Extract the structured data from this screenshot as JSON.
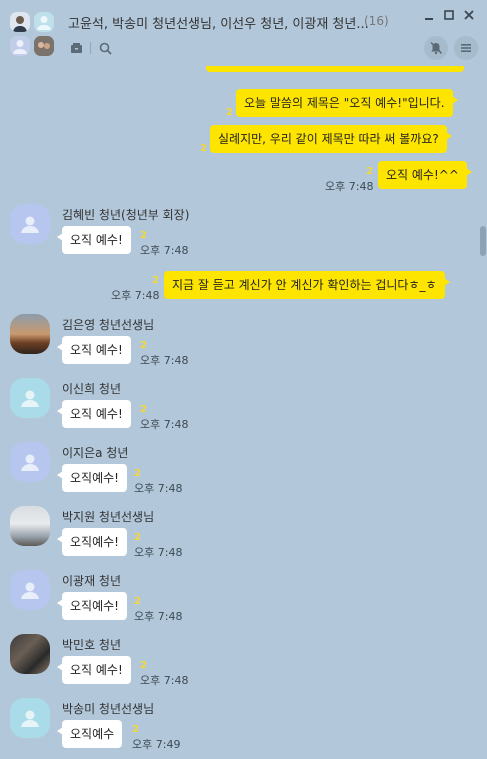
{
  "header": {
    "title": "고윤석, 박송미 청년선생님, 이선우 청년, 이광재 청년...",
    "member_count": "(16)",
    "window_buttons": [
      "minimize-icon",
      "maximize-icon",
      "close-icon"
    ],
    "tools": [
      "archive-icon",
      "search-icon"
    ],
    "actions": [
      "notification-off-icon",
      "menu-icon"
    ]
  },
  "messages": {
    "m1": {
      "text": "오늘 말씀의 제목은 \"오직 예수!\"입니다.",
      "unread": "2"
    },
    "m2": {
      "text": "실례지만, 우리 같이 제목만 따라 써 볼까요?",
      "unread": "2"
    },
    "m3": {
      "text": "오직 예수!^^",
      "unread": "2",
      "time": "오후 7:48"
    },
    "m4": {
      "sender": "김혜빈 청년(청년부 회장)",
      "text": "오직 예수!",
      "unread": "2",
      "time": "오후 7:48"
    },
    "m5": {
      "text": "지금 잘 듣고 계신가 안 계신가 확인하는 겁니다ㅎ_ㅎ",
      "unread": "2",
      "time": "오후 7:48"
    },
    "m6": {
      "sender": "김은영 청년선생님",
      "text": "오직 예수!",
      "unread": "2",
      "time": "오후 7:48"
    },
    "m7": {
      "sender": "이신희 청년",
      "text": "오직 예수!",
      "unread": "2",
      "time": "오후 7:48"
    },
    "m8": {
      "sender": "이지은a 청년",
      "text": "오직예수!",
      "unread": "2",
      "time": "오후 7:48"
    },
    "m9": {
      "sender": "박지원 청년선생님",
      "text": "오직예수!",
      "unread": "2",
      "time": "오후 7:48"
    },
    "m10": {
      "sender": "이광재 청년",
      "text": "오직예수!",
      "unread": "2",
      "time": "오후 7:48"
    },
    "m11": {
      "sender": "박민호 청년",
      "text": "오직 예수!",
      "unread": "2",
      "time": "오후 7:48"
    },
    "m12": {
      "sender": "박송미 청년선생님",
      "text": "오직예수",
      "unread": "2",
      "time": "오후 7:49"
    }
  },
  "colors": {
    "background": "#b2c7d9",
    "my_bubble": "#fee500",
    "their_bubble": "#ffffff",
    "unread_count": "#f2d63a"
  }
}
